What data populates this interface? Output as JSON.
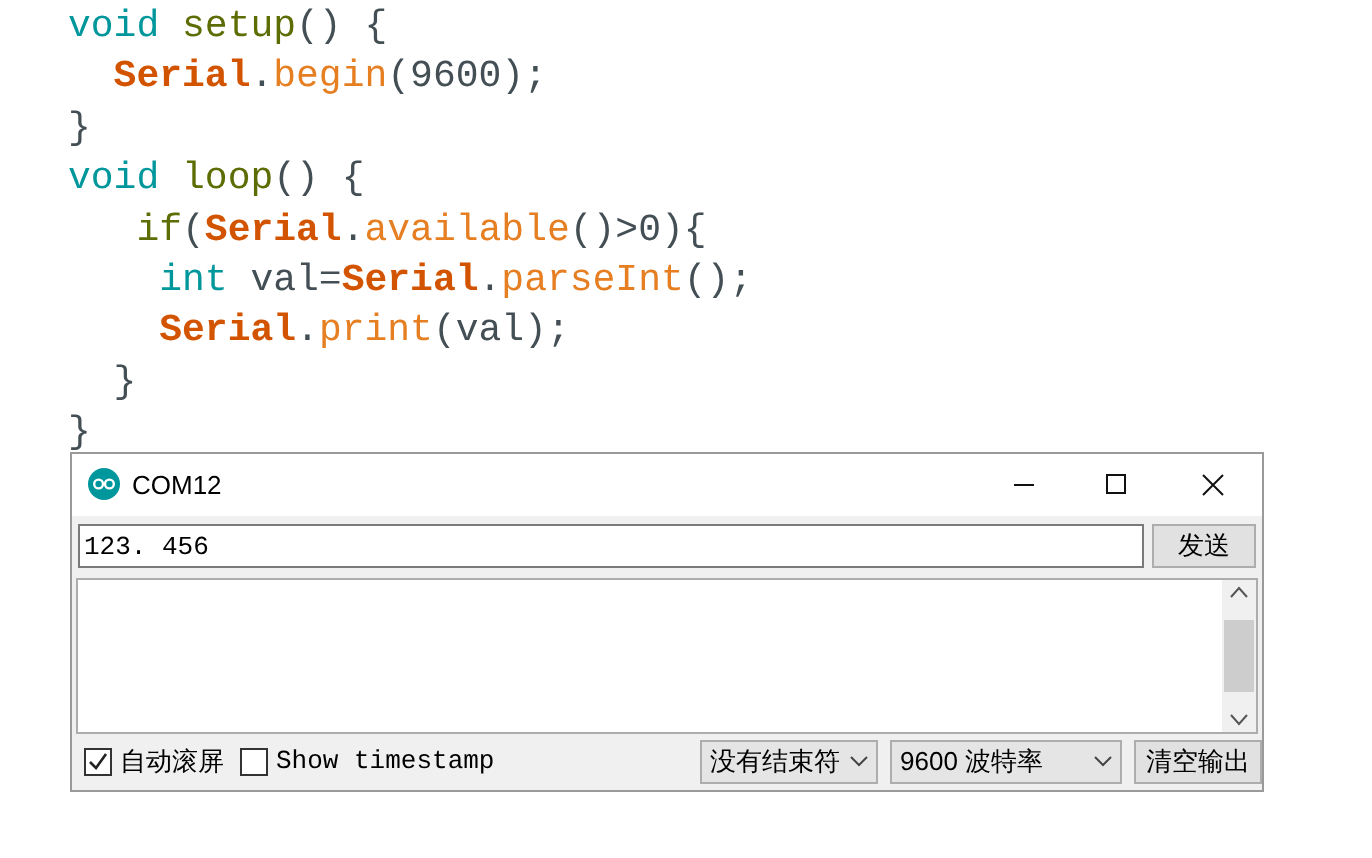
{
  "code_lines": [
    {
      "tokens": [
        {
          "kind": "keyword",
          "text": "void "
        },
        {
          "kind": "function",
          "text": "setup"
        },
        {
          "kind": "plain",
          "text": "() {"
        }
      ]
    },
    {
      "tokens": [
        {
          "kind": "class",
          "text": "  Serial"
        },
        {
          "kind": "plain",
          "text": "."
        },
        {
          "kind": "method",
          "text": "begin"
        },
        {
          "kind": "plain",
          "text": "(9600);"
        }
      ]
    },
    {
      "tokens": [
        {
          "kind": "plain",
          "text": "}"
        }
      ]
    },
    {
      "tokens": [
        {
          "kind": "keyword",
          "text": "void "
        },
        {
          "kind": "function",
          "text": "loop"
        },
        {
          "kind": "plain",
          "text": "() {"
        }
      ]
    },
    {
      "tokens": [
        {
          "kind": "function",
          "text": "   if"
        },
        {
          "kind": "plain",
          "text": "("
        },
        {
          "kind": "class",
          "text": "Serial"
        },
        {
          "kind": "plain",
          "text": "."
        },
        {
          "kind": "method",
          "text": "available"
        },
        {
          "kind": "plain",
          "text": "()>0){"
        }
      ]
    },
    {
      "tokens": [
        {
          "kind": "keyword",
          "text": "    int"
        },
        {
          "kind": "plain",
          "text": " val="
        },
        {
          "kind": "class",
          "text": "Serial"
        },
        {
          "kind": "plain",
          "text": "."
        },
        {
          "kind": "method",
          "text": "parseInt"
        },
        {
          "kind": "plain",
          "text": "();"
        }
      ]
    },
    {
      "tokens": [
        {
          "kind": "class",
          "text": "    Serial"
        },
        {
          "kind": "plain",
          "text": "."
        },
        {
          "kind": "method",
          "text": "print"
        },
        {
          "kind": "plain",
          "text": "(val);"
        }
      ]
    },
    {
      "tokens": [
        {
          "kind": "plain",
          "text": "  }"
        }
      ]
    },
    {
      "tokens": [
        {
          "kind": "plain",
          "text": "}"
        }
      ]
    }
  ],
  "serial_monitor": {
    "title": "COM12",
    "input": {
      "value": "123. 456"
    },
    "send_button": "发送",
    "autoscroll": {
      "label": "自动滚屏",
      "checked": true
    },
    "timestamp": {
      "label": "Show timestamp",
      "checked": false
    },
    "line_ending": "没有结束符",
    "baud_rate": "9600 波特率",
    "clear_button": "清空输出"
  }
}
